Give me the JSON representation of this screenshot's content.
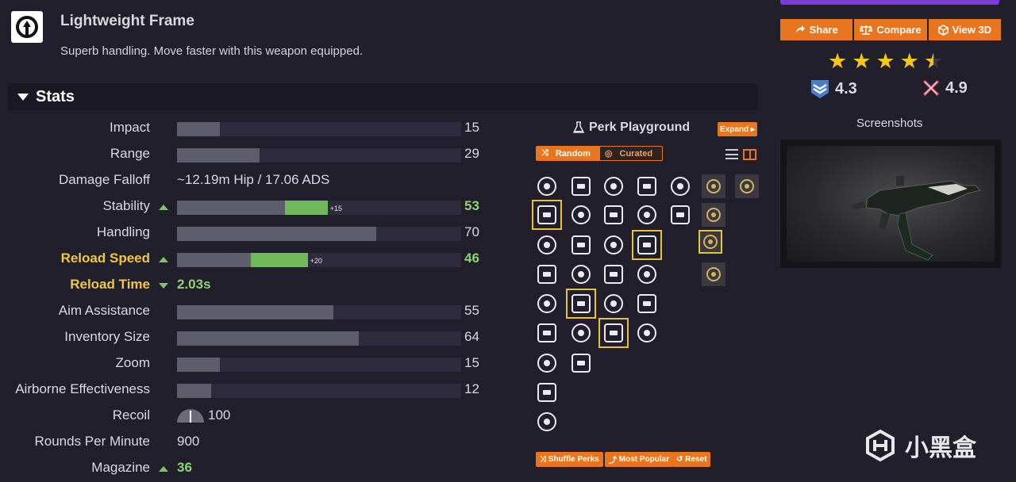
{
  "frame": {
    "title": "Lightweight Frame",
    "description": "Superb handling. Move faster with this weapon equipped."
  },
  "stats_section": {
    "label": "Stats"
  },
  "stats": [
    {
      "name": "Impact",
      "value": "15",
      "fill": 15
    },
    {
      "name": "Range",
      "value": "29",
      "fill": 29
    },
    {
      "name": "Damage Falloff",
      "text": "~12.19m Hip / 17.06 ADS"
    },
    {
      "name": "Stability",
      "value": "53",
      "fill": 38,
      "bonus": 15,
      "bonus_label": "+15",
      "trend": "up"
    },
    {
      "name": "Handling",
      "value": "70",
      "fill": 70
    },
    {
      "name": "Reload Speed",
      "value": "46",
      "fill": 26,
      "bonus": 20,
      "bonus_label": "+20",
      "trend": "up"
    },
    {
      "name": "Reload Time",
      "text": "2.03s",
      "trend": "down"
    },
    {
      "name": "Aim Assistance",
      "value": "55",
      "fill": 55
    },
    {
      "name": "Inventory Size",
      "value": "64",
      "fill": 64
    },
    {
      "name": "Zoom",
      "value": "15",
      "fill": 15
    },
    {
      "name": "Airborne Effectiveness",
      "value": "12",
      "fill": 12
    },
    {
      "name": "Recoil",
      "value": "100"
    },
    {
      "name": "Rounds Per Minute",
      "text": "900"
    },
    {
      "name": "Magazine",
      "value": "36",
      "trend": "up"
    }
  ],
  "perk_playground": {
    "title": "Perk Playground",
    "expand_label": "Expand",
    "mode_random": "Random",
    "mode_curated": "Curated",
    "shuffle_label": "Shuffle Perks",
    "popular_label": "Most Popular",
    "reset_label": "Reset"
  },
  "actions": {
    "share": "Share",
    "compare": "Compare",
    "view3d": "View 3D"
  },
  "ratings": {
    "stars": 4.5,
    "pve": "4.3",
    "pvp": "4.9"
  },
  "screenshots_label": "Screenshots",
  "watermark": "小黑盒"
}
